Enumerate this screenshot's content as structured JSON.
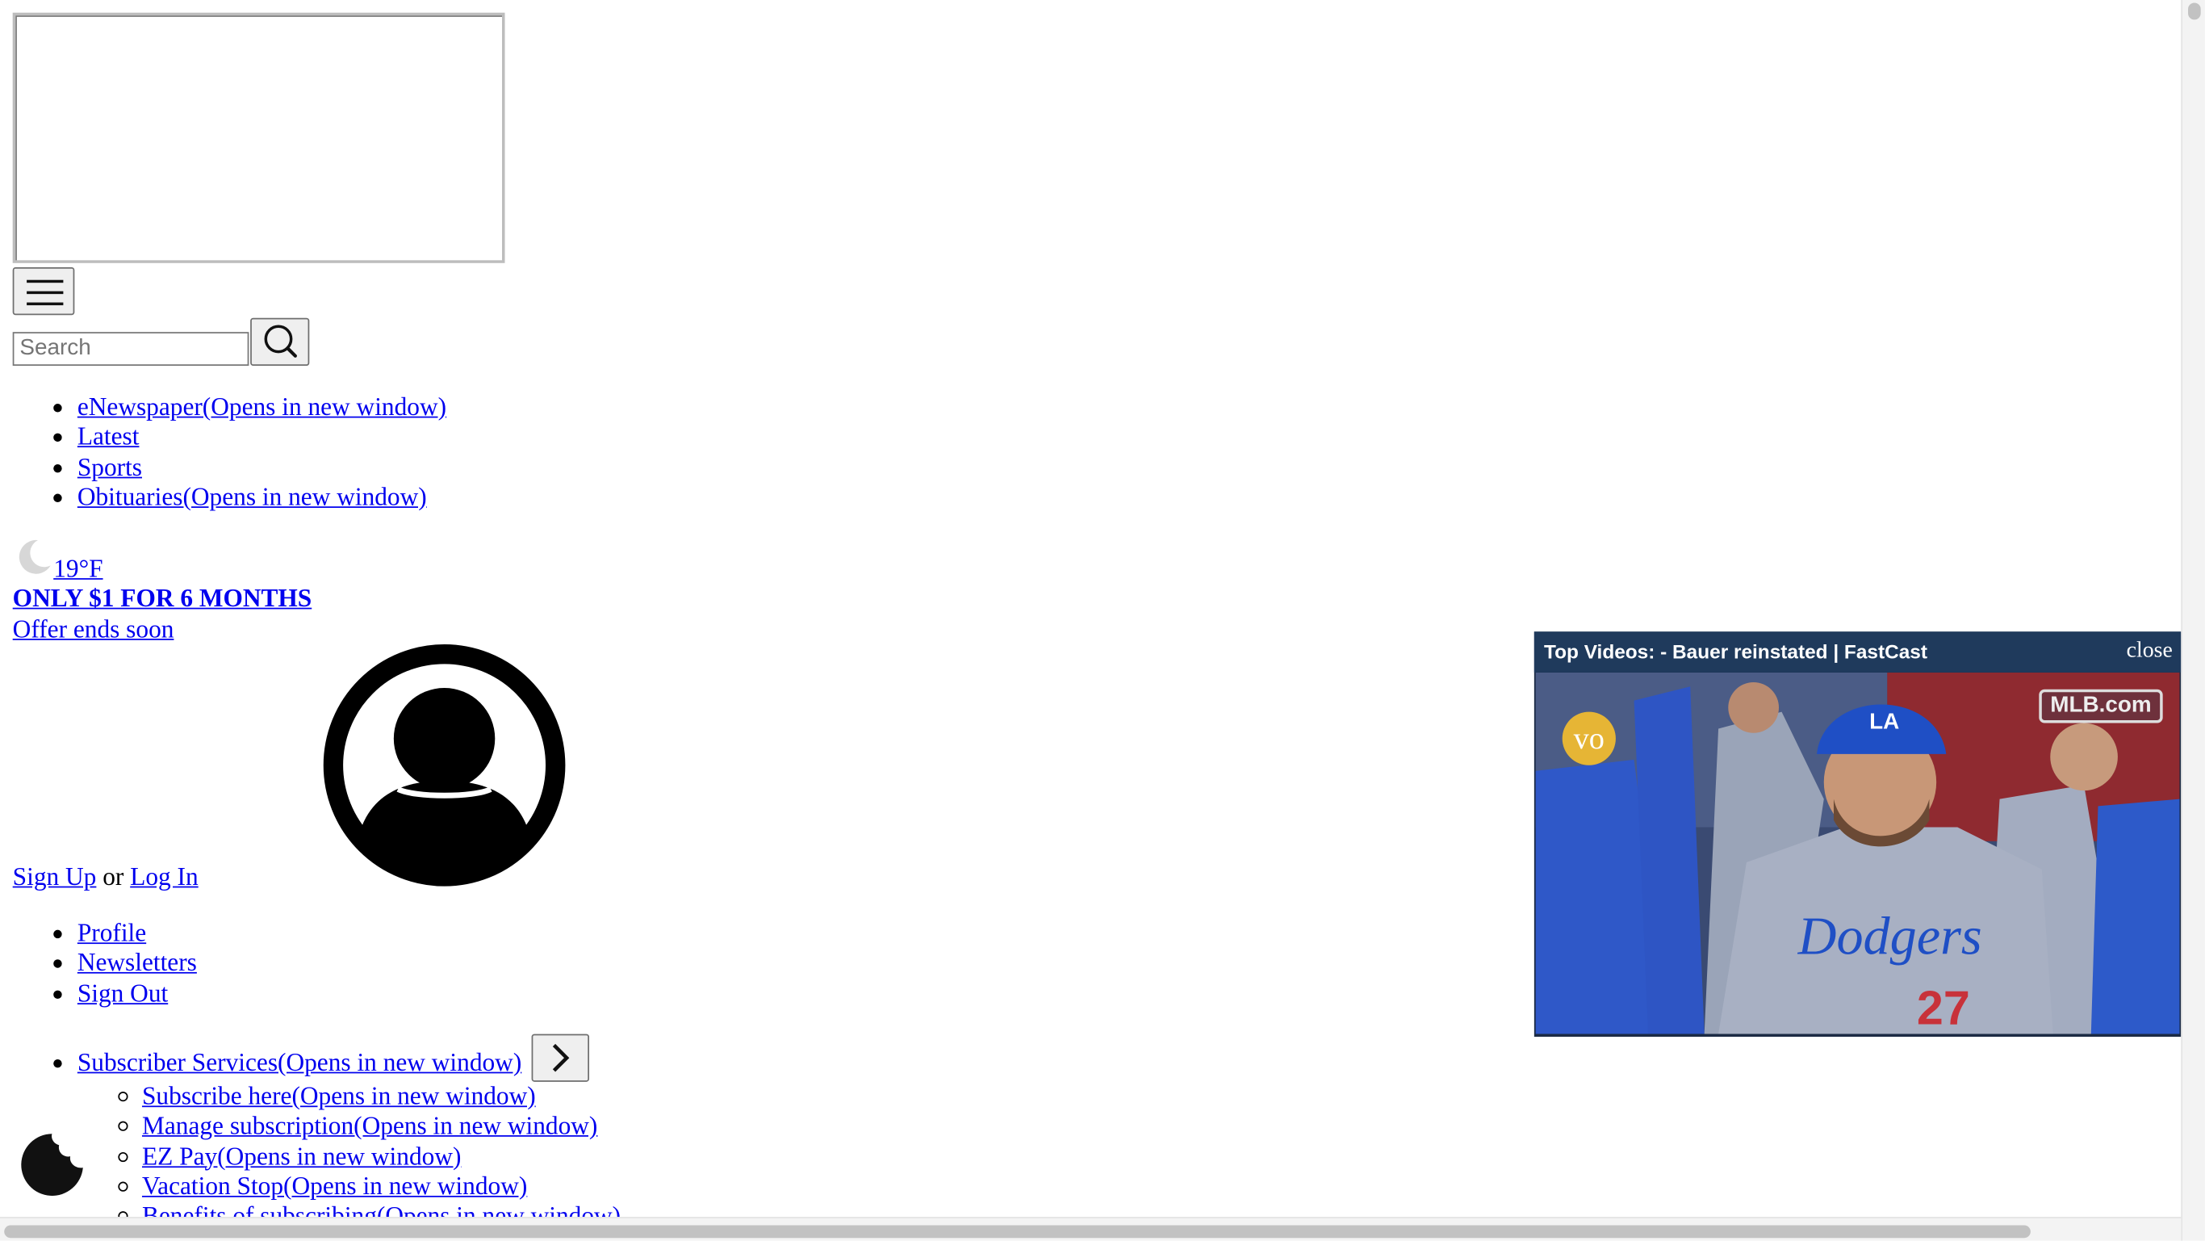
{
  "search": {
    "placeholder": "Search"
  },
  "nav": {
    "items": [
      {
        "label": "eNewspaper(Opens in new window)"
      },
      {
        "label": "Latest"
      },
      {
        "label": "Sports"
      },
      {
        "label": "Obituaries(Opens in new window)"
      }
    ]
  },
  "weather": {
    "temp": "19°F",
    "icon": "moon-icon"
  },
  "promo": {
    "headline": "ONLY $1 FOR 6 MONTHS",
    "subline": "Offer ends soon"
  },
  "auth": {
    "signup": "Sign Up",
    "or": "or",
    "login": "Log In"
  },
  "account": {
    "items": [
      {
        "label": "Profile"
      },
      {
        "label": "Newsletters"
      },
      {
        "label": "Sign Out"
      }
    ]
  },
  "subscriber": {
    "label": "Subscriber Services(Opens in new window)",
    "items": [
      {
        "label": "Subscribe here(Opens in new window)"
      },
      {
        "label": "Manage subscription(Opens in new window)"
      },
      {
        "label": "EZ Pay(Opens in new window)"
      },
      {
        "label": "Vacation Stop(Opens in new window)"
      },
      {
        "label": "Benefits of subscribing(Opens in new window)"
      }
    ]
  },
  "video": {
    "title": "Top Videos: - Bauer reinstated | FastCast",
    "close": "close",
    "badge": "vo",
    "watermark": "MLB.com",
    "jersey_text": "Dodgers",
    "jersey_number": "27",
    "cap_logo": "LA"
  },
  "colors": {
    "link": "#0000ee",
    "video_header": "#1f3a5c",
    "badge": "#e6b535"
  }
}
